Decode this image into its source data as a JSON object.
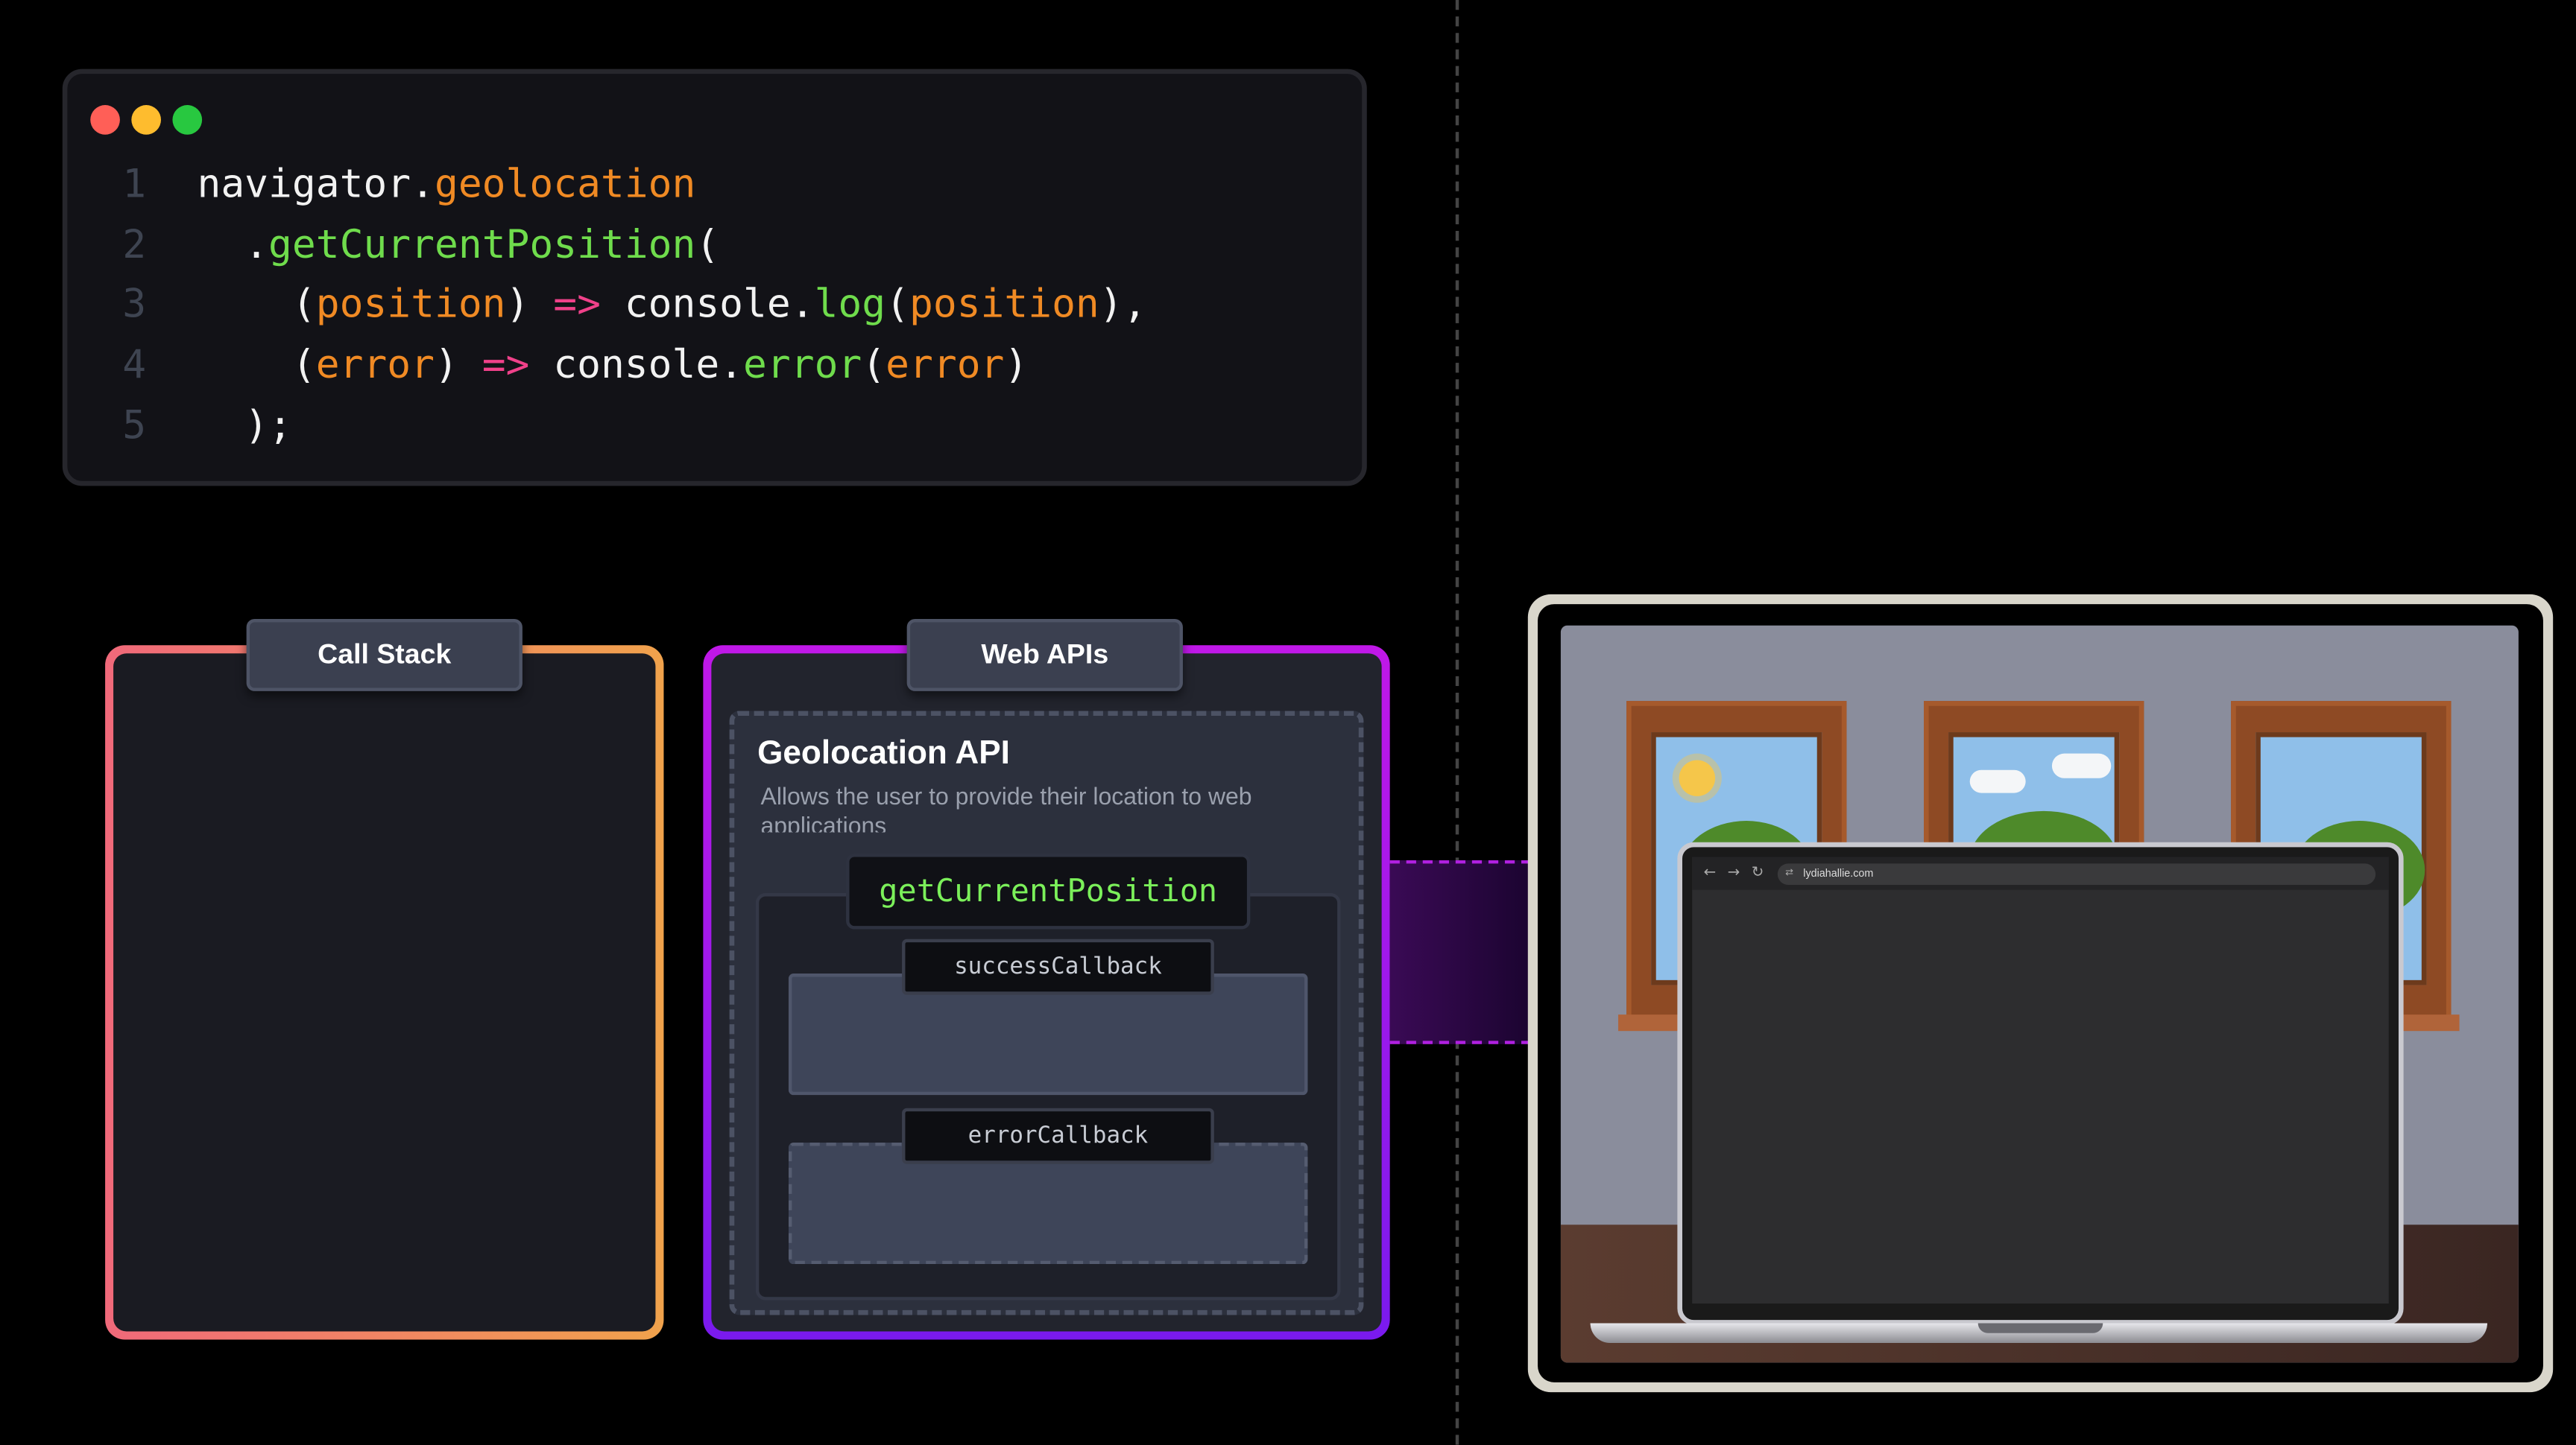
{
  "code": {
    "lines": [
      {
        "num": "1",
        "tokens": [
          {
            "t": "navigator.",
            "c": "plain"
          },
          {
            "t": "geolocation",
            "c": "prop"
          }
        ]
      },
      {
        "num": "2",
        "tokens": [
          {
            "t": "  .",
            "c": "plain"
          },
          {
            "t": "getCurrentPosition",
            "c": "fn"
          },
          {
            "t": "(",
            "c": "plain"
          }
        ]
      },
      {
        "num": "3",
        "tokens": [
          {
            "t": "    (",
            "c": "plain"
          },
          {
            "t": "position",
            "c": "prop"
          },
          {
            "t": ") ",
            "c": "plain"
          },
          {
            "t": "=>",
            "c": "arrow"
          },
          {
            "t": " console.",
            "c": "plain"
          },
          {
            "t": "log",
            "c": "fn"
          },
          {
            "t": "(",
            "c": "plain"
          },
          {
            "t": "position",
            "c": "prop"
          },
          {
            "t": "),",
            "c": "plain"
          }
        ]
      },
      {
        "num": "4",
        "tokens": [
          {
            "t": "    (",
            "c": "plain"
          },
          {
            "t": "error",
            "c": "prop"
          },
          {
            "t": ") ",
            "c": "plain"
          },
          {
            "t": "=>",
            "c": "arrow"
          },
          {
            "t": " console.",
            "c": "plain"
          },
          {
            "t": "error",
            "c": "fn"
          },
          {
            "t": "(",
            "c": "plain"
          },
          {
            "t": "error",
            "c": "prop"
          },
          {
            "t": ")",
            "c": "plain"
          }
        ]
      },
      {
        "num": "5",
        "tokens": [
          {
            "t": "  );",
            "c": "plain"
          }
        ]
      }
    ],
    "dots": [
      "#ff5f57",
      "#febc2e",
      "#28c840"
    ]
  },
  "call_stack": {
    "label": "Call Stack"
  },
  "web_apis": {
    "label": "Web APIs",
    "geolocation": {
      "title": "Geolocation API",
      "description": "Allows the user to provide their location to web applications",
      "method": "getCurrentPosition",
      "success_label": "successCallback",
      "error_label": "errorCallback"
    }
  },
  "browser": {
    "url": "lydiahallie.com",
    "nav": {
      "back": "←",
      "forward": "→",
      "reload": "↻",
      "site_icon": "⇄"
    }
  }
}
